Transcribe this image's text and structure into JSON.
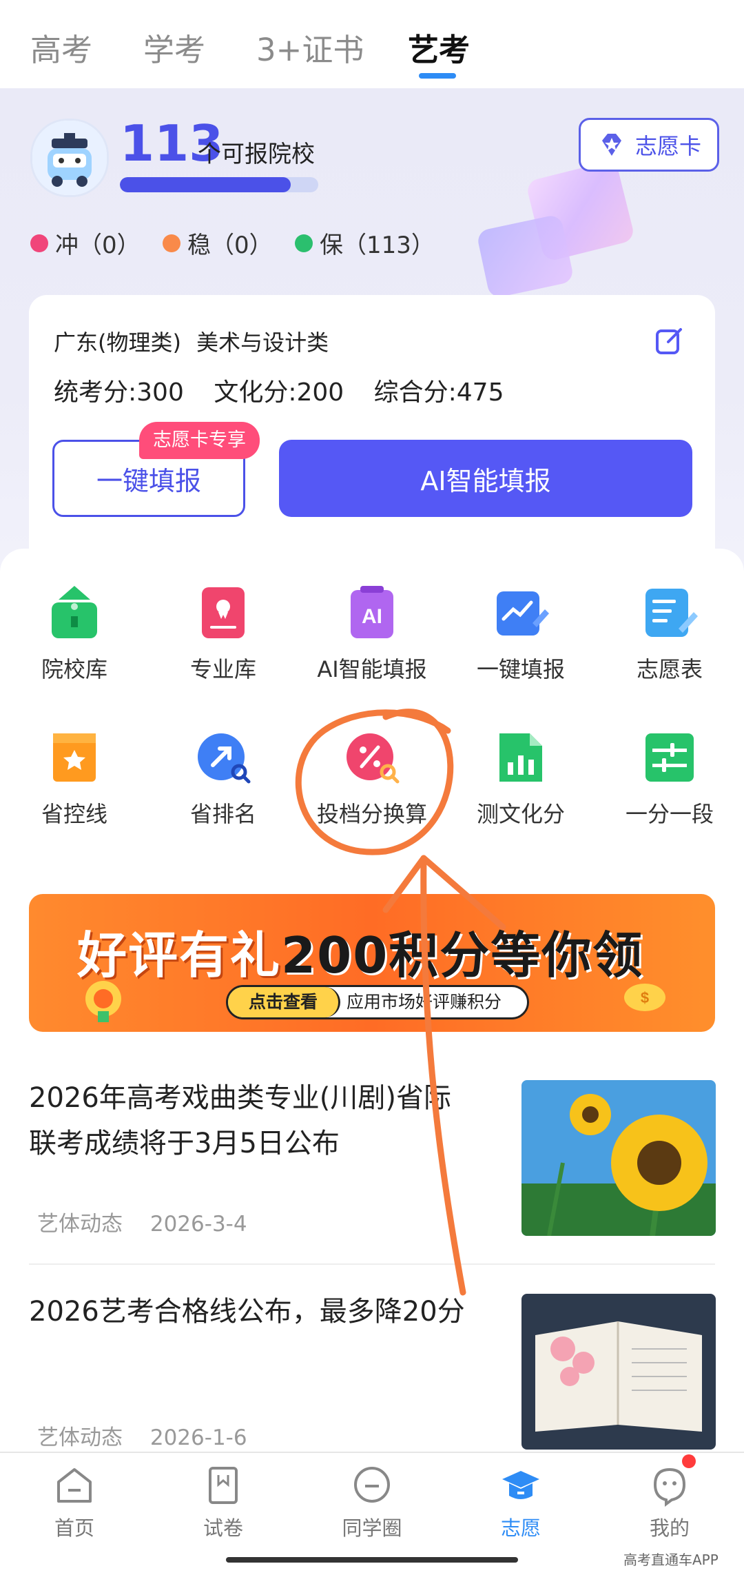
{
  "tabs": [
    {
      "label": "高考",
      "active": false
    },
    {
      "label": "学考",
      "active": false
    },
    {
      "label": "3+证书",
      "active": false
    },
    {
      "label": "艺考",
      "active": true
    }
  ],
  "hero": {
    "count": "113",
    "count_unit": "个可报院校",
    "progress": 0.86,
    "card_button": "志愿卡",
    "legend": [
      {
        "label": "冲（0）",
        "color": "#f0457a"
      },
      {
        "label": "稳（0）",
        "color": "#f98a4a"
      },
      {
        "label": "保（113）",
        "color": "#2bbf6e"
      }
    ]
  },
  "profile": {
    "region": "广东(物理类)",
    "major_type": "美术与设计类",
    "scores": [
      {
        "label": "统考分:",
        "value": "300"
      },
      {
        "label": "文化分:",
        "value": "200"
      },
      {
        "label": "综合分:",
        "value": "475"
      }
    ],
    "one_key_button": "一键填报",
    "exclusive_tag": "志愿卡专享",
    "ai_button": "AI智能填报"
  },
  "tools": [
    {
      "label": "院校库",
      "icon": "school-icon",
      "color": "#27c36a"
    },
    {
      "label": "专业库",
      "icon": "major-book-icon",
      "color": "#f0456d"
    },
    {
      "label": "AI智能填报",
      "icon": "ai-icon",
      "color": "#b066f0"
    },
    {
      "label": "一键填报",
      "icon": "chart-pen-icon",
      "color": "#3f7ff5"
    },
    {
      "label": "志愿表",
      "icon": "list-pen-icon",
      "color": "#3ea7f2"
    },
    {
      "label": "省控线",
      "icon": "star-ribbon-icon",
      "color": "#ff9a1f"
    },
    {
      "label": "省排名",
      "icon": "rank-arrow-icon",
      "color": "#3f7ff5"
    },
    {
      "label": "投档分换算",
      "icon": "percent-convert-icon",
      "color": "#f0456d"
    },
    {
      "label": "测文化分",
      "icon": "sheet-chart-icon",
      "color": "#27c36a"
    },
    {
      "label": "一分一段",
      "icon": "sliders-icon",
      "color": "#27c36a"
    }
  ],
  "banner": {
    "title_part1": "好评有礼",
    "title_part2": "200积分等你领",
    "cta": "点击查看",
    "text": "应用市场好评赚积分"
  },
  "news": [
    {
      "title": "2026年高考戏曲类专业(川剧)省际联考成绩将于3月5日公布",
      "tag": "艺体动态",
      "date": "2026-3-4",
      "image": "sunflower-photo"
    },
    {
      "title": "2026艺考合格线公布，最多降20分",
      "tag": "艺体动态",
      "date": "2026-1-6",
      "image": "open-book-photo"
    }
  ],
  "bottom_nav": [
    {
      "label": "首页",
      "icon": "home-icon",
      "active": false
    },
    {
      "label": "试卷",
      "icon": "paper-icon",
      "active": false
    },
    {
      "label": "同学圈",
      "icon": "chat-circle-icon",
      "active": false
    },
    {
      "label": "志愿",
      "icon": "graduation-cap-icon",
      "active": true
    },
    {
      "label": "我的",
      "icon": "profile-face-icon",
      "active": false,
      "badge": true
    }
  ],
  "watermark": "高考直通车APP",
  "colors": {
    "accent": "#4b51e8",
    "tab_underline": "#2e8cf5",
    "annotation": "#f47a3c"
  }
}
